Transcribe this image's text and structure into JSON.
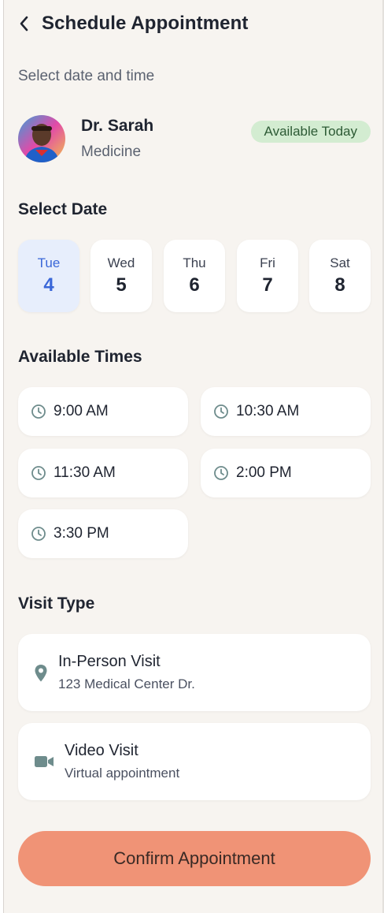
{
  "header": {
    "title": "Schedule Appointment",
    "back_icon": "chevron-left-icon"
  },
  "subtitle": "Select date and time",
  "doctor": {
    "name": "Dr. Sarah",
    "specialty": "Medicine",
    "badge": "Available Today",
    "badge_color": "#d3ecd1"
  },
  "dates_section": {
    "title": "Select Date",
    "selected_index": 0,
    "items": [
      {
        "day": "Tue",
        "num": "4"
      },
      {
        "day": "Wed",
        "num": "5"
      },
      {
        "day": "Thu",
        "num": "6"
      },
      {
        "day": "Fri",
        "num": "7"
      },
      {
        "day": "Sat",
        "num": "8"
      }
    ]
  },
  "times_section": {
    "title": "Available Times",
    "icon": "clock-icon",
    "slots": [
      "9:00 AM",
      "10:30 AM",
      "11:30 AM",
      "2:00 PM",
      "3:30 PM"
    ]
  },
  "visit_section": {
    "title": "Visit Type",
    "options": [
      {
        "title": "In-Person Visit",
        "subtitle": "123 Medical Center Dr.",
        "icon": "location-pin-icon"
      },
      {
        "title": "Video Visit",
        "subtitle": "Virtual appointment",
        "icon": "video-camera-icon"
      }
    ]
  },
  "confirm_button": {
    "label": "Confirm Appointment",
    "color": "#f09376"
  },
  "colors": {
    "accent": "#3a67d8",
    "background": "#f7f4f0",
    "icon_gray": "#6e8c8c"
  }
}
